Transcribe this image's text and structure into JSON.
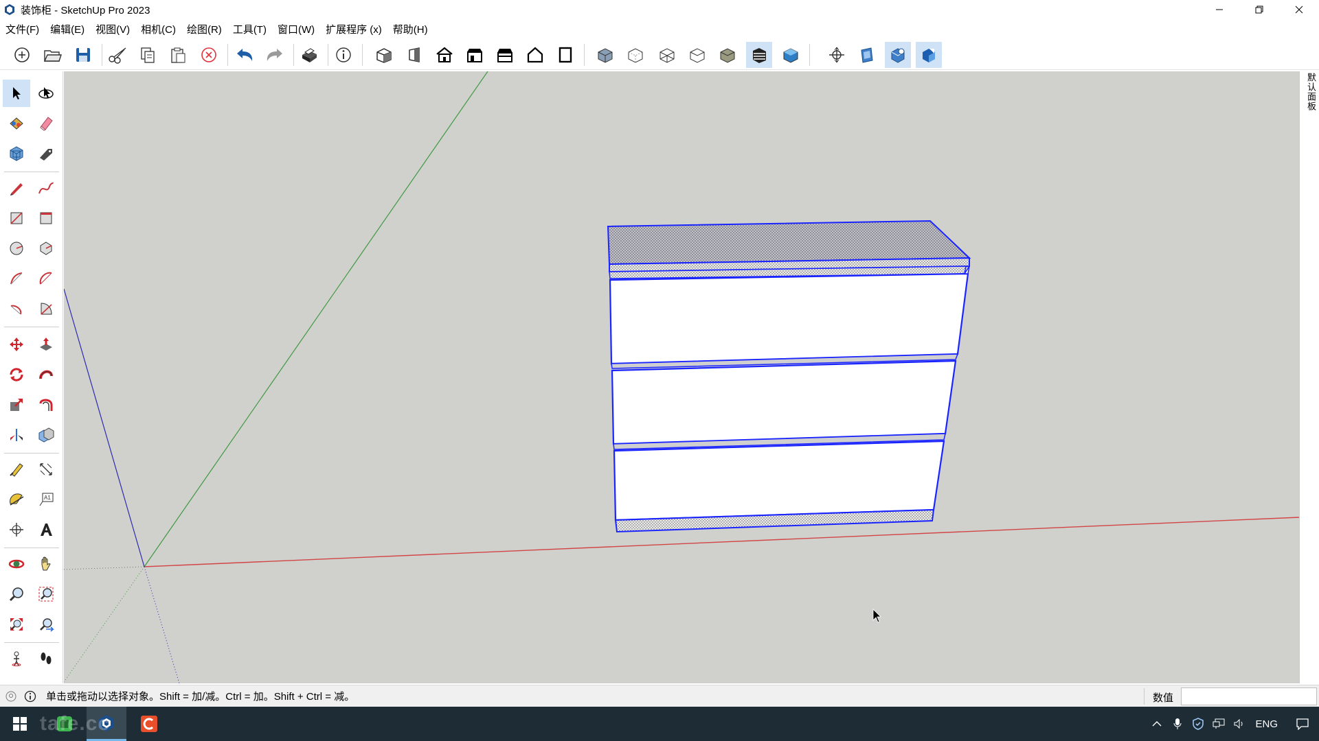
{
  "window": {
    "title": "装饰柜 - SketchUp Pro 2023"
  },
  "menubar": [
    "文件(F)",
    "编辑(E)",
    "视图(V)",
    "相机(C)",
    "绘图(R)",
    "工具(T)",
    "窗口(W)",
    "扩展程序 (x)",
    "帮助(H)"
  ],
  "toolbar": {
    "groups": [
      [
        "new-icon",
        "open-icon",
        "save-icon"
      ],
      [
        "cut-icon",
        "copy-icon",
        "paste-icon",
        "erase-selection-icon"
      ],
      [
        "undo-icon",
        "redo-icon"
      ],
      [
        "print-icon"
      ],
      [
        "model-info-icon"
      ],
      [
        "iso-view-icon",
        "top-view-icon",
        "front-view-icon",
        "right-view-icon",
        "back-view-icon",
        "left-view-icon",
        "bottom-view-icon"
      ],
      [
        "xray-icon",
        "back-edges-icon",
        "wireframe-icon",
        "hidden-line-icon",
        "shaded-icon",
        "shaded-textures-icon",
        "monochrome-icon"
      ],
      [
        "section-plane-icon",
        "display-section-planes-icon",
        "display-section-cuts-icon",
        "display-section-fill-icon"
      ]
    ],
    "active": [
      "shaded-textures-icon",
      "display-section-cuts-icon",
      "display-section-fill-icon"
    ]
  },
  "left_tools": [
    [
      "select-icon",
      "orbit-component-icon"
    ],
    [
      "paint-bucket-icon",
      "eraser-icon"
    ],
    [
      "make-component-icon",
      "tag-icon"
    ],
    [
      "line-icon",
      "freehand-icon"
    ],
    [
      "rectangle-icon",
      "rotated-rectangle-icon"
    ],
    [
      "circle-icon",
      "polygon-icon"
    ],
    [
      "arc-icon",
      "two-point-arc-icon"
    ],
    [
      "three-point-arc-icon",
      "pie-icon"
    ],
    [
      "move-icon",
      "push-pull-icon"
    ],
    [
      "rotate-icon",
      "follow-me-icon"
    ],
    [
      "scale-icon",
      "offset-icon"
    ],
    [
      "flip-icon",
      "solid-tools-icon"
    ],
    [
      "tape-measure-icon",
      "dimension-icon"
    ],
    [
      "protractor-icon",
      "text-icon"
    ],
    [
      "axes-icon",
      "3d-text-icon"
    ],
    [
      "orbit-icon",
      "pan-icon"
    ],
    [
      "zoom-icon",
      "zoom-window-icon"
    ],
    [
      "zoom-extents-icon",
      "previous-view-icon"
    ],
    [
      "position-camera-icon",
      "walk-icon"
    ]
  ],
  "right_panel": {
    "tab_label": "默认面板"
  },
  "status": {
    "text": "单击或拖动以选择对象。Shift = 加/减。Ctrl = 加。Shift + Ctrl = 减。",
    "measure_label": "数值",
    "measure_value": ""
  },
  "taskbar": {
    "watermark": "tafe.cc",
    "apps": [
      "windows-start-icon",
      "green-app-icon",
      "sketchup-app-icon",
      "orange-app-icon"
    ],
    "active_app": "sketchup-app-icon",
    "tray_lang": "ENG"
  },
  "colors": {
    "accent": "#cfe2f6",
    "viewport_bg": "#d0d0cd",
    "selection_blue": "#1a24ff",
    "red_axis": "#d24545",
    "green_axis": "#3f9a3f",
    "blue_axis": "#2b2bb0"
  }
}
